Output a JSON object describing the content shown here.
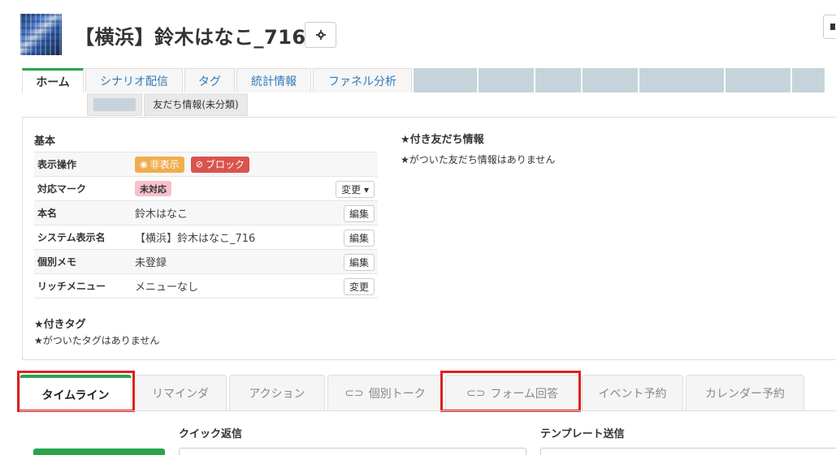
{
  "header": {
    "title": "【横浜】鈴木はなこ_716",
    "settings_icon": "gear-icon"
  },
  "top_tabs": [
    {
      "label": "ホーム",
      "active": true
    },
    {
      "label": "シナリオ配信",
      "active": false
    },
    {
      "label": "タグ",
      "active": false
    },
    {
      "label": "統計情報",
      "active": false
    },
    {
      "label": "ファネル分析",
      "active": false
    }
  ],
  "sub_tabs": [
    {
      "label": "友だち情報(未分類)"
    }
  ],
  "basic": {
    "title": "基本",
    "rows": [
      {
        "label": "表示操作",
        "value": ""
      },
      {
        "label": "対応マーク",
        "value": "",
        "action": "変更 ▾"
      },
      {
        "label": "本名",
        "value": "鈴木はなこ",
        "action": "編集"
      },
      {
        "label": "システム表示名",
        "value": "【横浜】鈴木はなこ_716",
        "action": "編集"
      },
      {
        "label": "個別メモ",
        "value": "未登録",
        "action": "編集"
      },
      {
        "label": "リッチメニュー",
        "value": "メニューなし",
        "action": "変更"
      }
    ],
    "hide_badge": "非表示",
    "block_badge": "ブロック",
    "status_badge": "未対応"
  },
  "friend_info": {
    "title": "★付き友だち情報",
    "empty": "★がついた友だち情報はありません"
  },
  "tags": {
    "title": "★付きタグ",
    "empty": "★がついたタグはありません"
  },
  "bottom_tabs": [
    {
      "label": "タイムライン",
      "active": true
    },
    {
      "label": "リマインダ"
    },
    {
      "label": "アクション"
    },
    {
      "label": "個別トーク",
      "icon": "link-icon"
    },
    {
      "label": "フォーム回答",
      "icon": "link-icon"
    },
    {
      "label": "イベント予約"
    },
    {
      "label": "カレンダー予約"
    }
  ],
  "quick_reply": {
    "title": "クイック返信"
  },
  "template": {
    "title": "テンプレート送信"
  },
  "colors": {
    "accent": "#2ba34b",
    "highlight": "#e02020",
    "link": "#337ab7"
  }
}
